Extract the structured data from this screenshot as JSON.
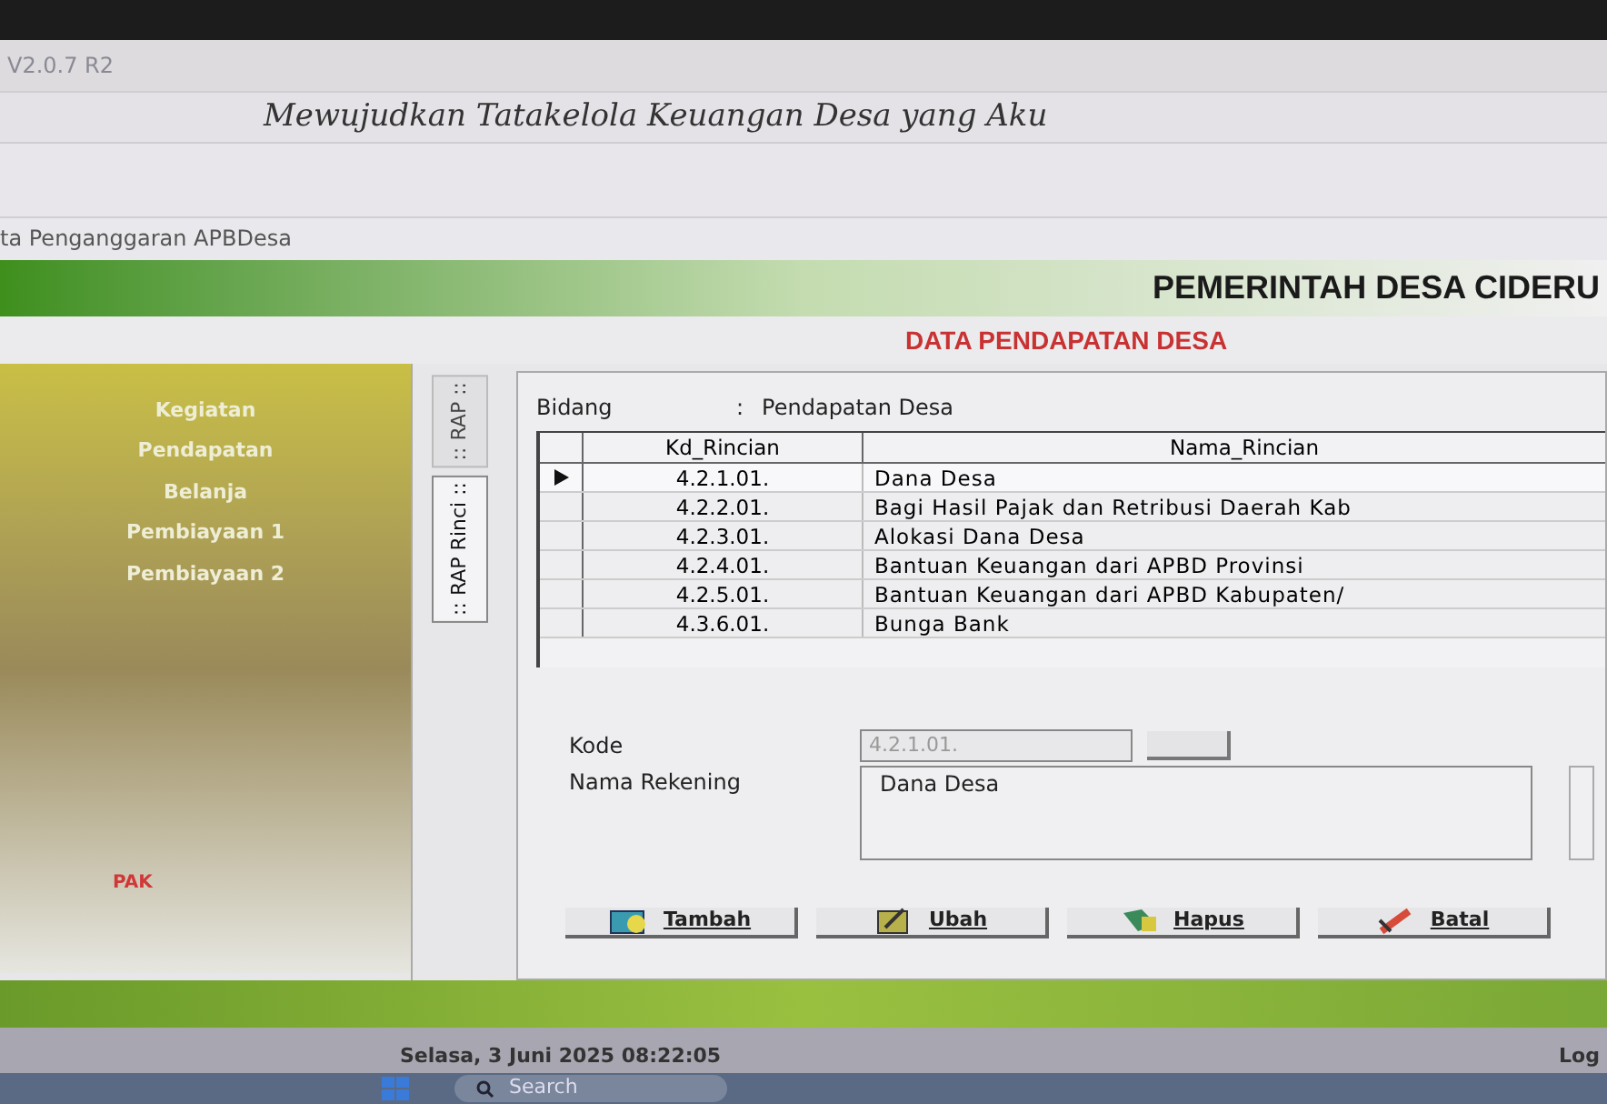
{
  "app_version": "V2.0.7 R2",
  "motto": "Mewujudkan Tatakelola Keuangan Desa yang Aku",
  "module_title": "ta Penganggaran APBDesa",
  "banner": "PEMERINTAH DESA CIDERU",
  "page_title": "DATA PENDAPATAN DESA",
  "side_menu": [
    {
      "label": "Kegiatan"
    },
    {
      "label": "Pendapatan"
    },
    {
      "label": "Belanja"
    },
    {
      "label": "Pembiayaan 1"
    },
    {
      "label": "Pembiayaan 2"
    }
  ],
  "side_link": "PAK",
  "tabs": [
    {
      "label": ":: RAP ::",
      "selected": false
    },
    {
      "label": ":: RAP Rinci ::",
      "selected": true
    }
  ],
  "bidang": {
    "label": "Bidang",
    "separator": ":",
    "value": "Pendapatan Desa"
  },
  "table": {
    "columns": [
      "Kd_Rincian",
      "Nama_Rincian"
    ],
    "rows": [
      {
        "code": "4.2.1.01.",
        "name": "Dana Desa",
        "selected": true
      },
      {
        "code": "4.2.2.01.",
        "name": "Bagi Hasil Pajak dan Retribusi Daerah Kab",
        "selected": false
      },
      {
        "code": "4.2.3.01.",
        "name": "Alokasi Dana Desa",
        "selected": false
      },
      {
        "code": "4.2.4.01.",
        "name": "Bantuan Keuangan dari APBD Provinsi",
        "selected": false
      },
      {
        "code": "4.2.5.01.",
        "name": "Bantuan Keuangan dari APBD Kabupaten/",
        "selected": false
      },
      {
        "code": "4.3.6.01.",
        "name": "Bunga Bank",
        "selected": false
      }
    ]
  },
  "form": {
    "kode_label": "Kode",
    "kode_value": "4.2.1.01.",
    "nama_label": "Nama Rekening",
    "nama_value": "Dana Desa"
  },
  "buttons": [
    {
      "label": "Tambah",
      "kind": "add"
    },
    {
      "label": "Ubah",
      "kind": "edit"
    },
    {
      "label": "Hapus",
      "kind": "delete"
    },
    {
      "label": "Batal",
      "kind": "cancel"
    }
  ],
  "status_bar": {
    "date": "Selasa, 3 Juni 2025  08:22:05",
    "right": "Log"
  },
  "taskbar": {
    "search": "Search"
  }
}
